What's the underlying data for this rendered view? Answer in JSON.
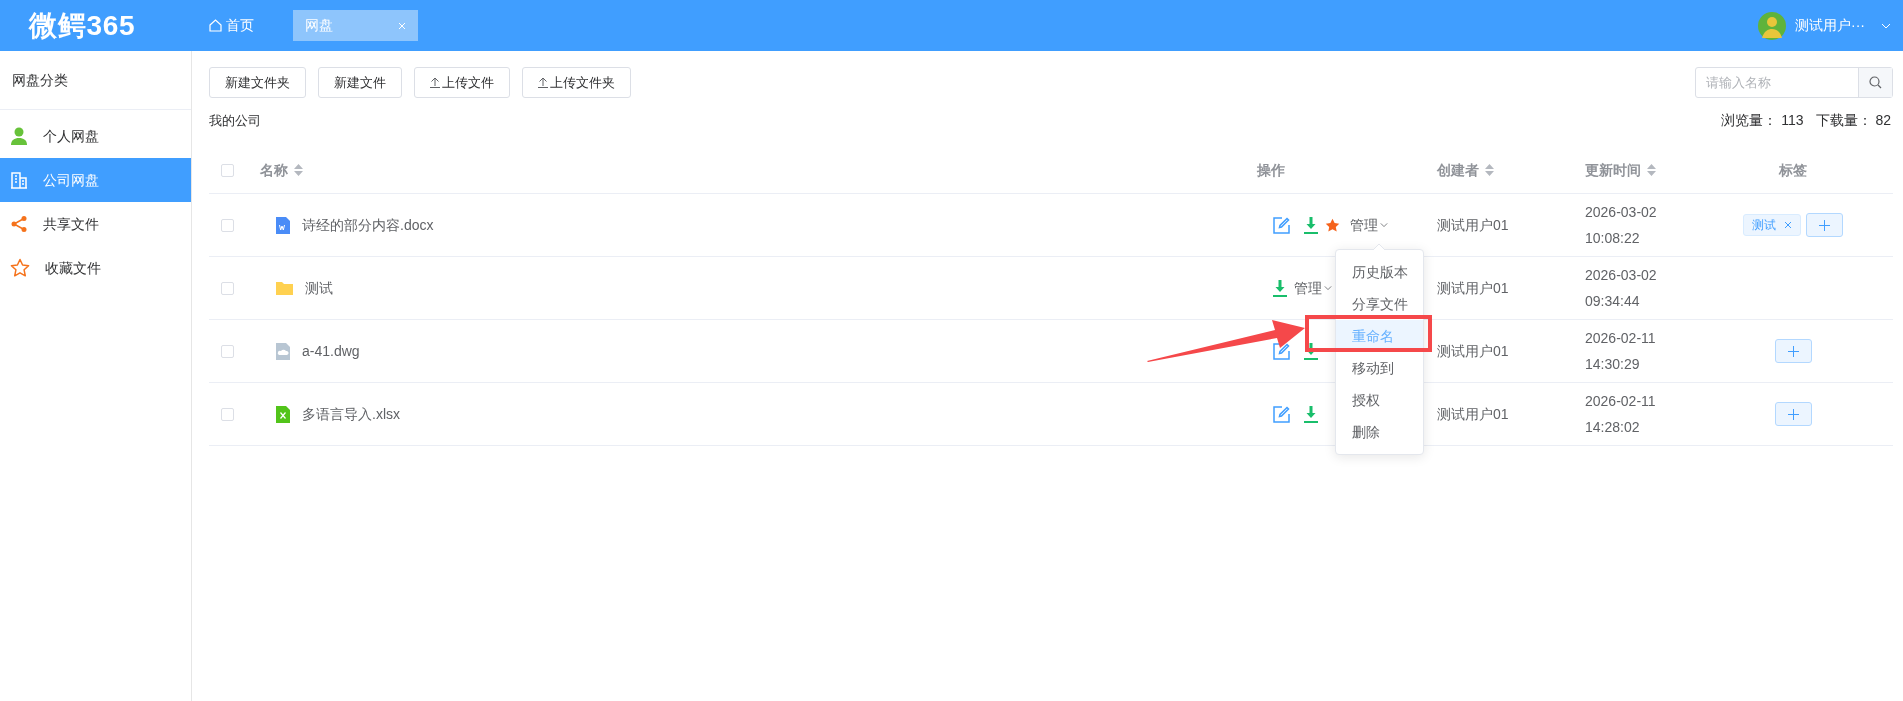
{
  "header": {
    "logo": "微鳄365",
    "home": "首页",
    "tabs": [
      {
        "label": "网盘",
        "selected": true
      }
    ],
    "user": "测试用户···"
  },
  "sidebar": {
    "title": "网盘分类",
    "items": [
      {
        "label": "个人网盘",
        "kind": "person",
        "selected": false
      },
      {
        "label": "公司网盘",
        "kind": "company",
        "selected": true
      },
      {
        "label": "共享文件",
        "kind": "share",
        "selected": false
      },
      {
        "label": "收藏文件",
        "kind": "star",
        "selected": false
      }
    ]
  },
  "toolbar": {
    "buttons": [
      {
        "label": "新建文件夹",
        "kind": "plain"
      },
      {
        "label": "新建文件",
        "kind": "plain"
      },
      {
        "label": "上传文件",
        "kind": "upload"
      },
      {
        "label": "上传文件夹",
        "kind": "upload"
      }
    ],
    "search": {
      "placeholder": "请输入名称"
    }
  },
  "breadcrumb": "我的公司",
  "stats": [
    {
      "label": "浏览量：",
      "value": "113"
    },
    {
      "label": "下载量：",
      "value": "82"
    }
  ],
  "table": {
    "select_all_checked": false,
    "columns": [
      {
        "label": "名称",
        "sortable": true
      },
      {
        "label": "操作",
        "sortable": false
      },
      {
        "label": "创建者",
        "sortable": true
      },
      {
        "label": "更新时间",
        "sortable": true
      },
      {
        "label": "标签",
        "sortable": false
      }
    ],
    "rows": [
      {
        "checked": false,
        "kind": "word",
        "name": "诗经的部分内容.docx",
        "actions": [
          {
            "kind": "edit"
          },
          {
            "kind": "download"
          },
          {
            "kind": "favorite"
          },
          {
            "kind": "manage",
            "label": "管理"
          }
        ],
        "creator": "测试用户01",
        "date": "2026-03-02",
        "time": "10:08:22",
        "tags": [
          "测试"
        ],
        "can_add_tag": true
      },
      {
        "checked": false,
        "kind": "folder",
        "name": "测试",
        "actions": [
          {
            "kind": "download"
          },
          {
            "kind": "manage",
            "label": "管理"
          }
        ],
        "creator": "测试用户01",
        "date": "2026-03-02",
        "time": "09:34:44",
        "tags": [],
        "can_add_tag": false
      },
      {
        "checked": false,
        "kind": "cad",
        "name": "a-41.dwg",
        "actions": [
          {
            "kind": "edit"
          },
          {
            "kind": "download"
          }
        ],
        "creator": "测试用户01",
        "date": "2026-02-11",
        "time": "14:30:29",
        "tags": [],
        "can_add_tag": true
      },
      {
        "checked": false,
        "kind": "excel",
        "name": "多语言导入.xlsx",
        "actions": [
          {
            "kind": "edit"
          },
          {
            "kind": "download"
          }
        ],
        "creator": "测试用户01",
        "date": "2026-02-11",
        "time": "14:28:02",
        "tags": [],
        "can_add_tag": true
      }
    ]
  },
  "manage_menu": {
    "items": [
      {
        "label": "历史版本",
        "selected": false
      },
      {
        "label": "分享文件",
        "selected": false
      },
      {
        "label": "重命名",
        "selected": true
      },
      {
        "label": "移动到",
        "selected": false
      },
      {
        "label": "授权",
        "selected": false
      },
      {
        "label": "删除",
        "selected": false
      }
    ]
  }
}
